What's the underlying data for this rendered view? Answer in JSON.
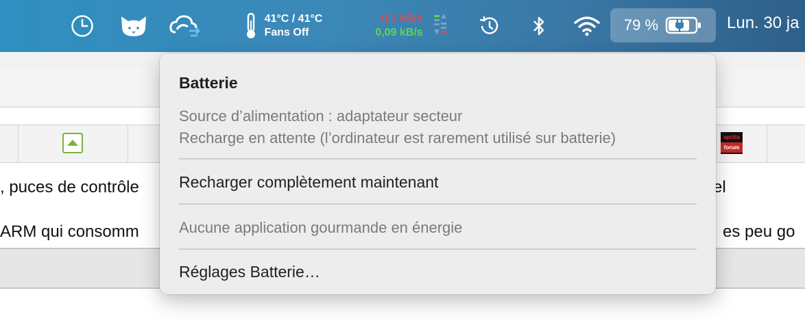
{
  "menubar": {
    "temperature": {
      "line1": "41°C / 41°C",
      "line2": "Fans Off"
    },
    "network": {
      "upload": "0,1 kB/s",
      "download": "0,09 kB/s"
    },
    "battery": {
      "percent": "79 %"
    },
    "clock": "Lun. 30 ja",
    "icons": [
      "clock-icon",
      "cat-icon",
      "sync-cloud-icon",
      "thermometer-icon",
      "network-meter-icon",
      "time-machine-icon",
      "bluetooth-icon",
      "wifi-icon",
      "battery-charging-icon"
    ],
    "colors": {
      "upload": "#e24a4a",
      "download": "#5fd35a"
    }
  },
  "background": {
    "line1": ", puces de contrôle",
    "line1_right": "el",
    "line2": " ARM qui consomm",
    "line2_right": "es peu go",
    "logo": {
      "top": "aprilia",
      "bottom": "forum"
    }
  },
  "menu": {
    "title": "Batterie",
    "source": "Source d’alimentation : adaptateur secteur",
    "status": "Recharge en attente (l’ordinateur est rarement utilisé sur batterie)",
    "recharge": "Recharger complètement maintenant",
    "no_apps": "Aucune application gourmande en énergie",
    "settings": "Réglages Batterie…"
  }
}
